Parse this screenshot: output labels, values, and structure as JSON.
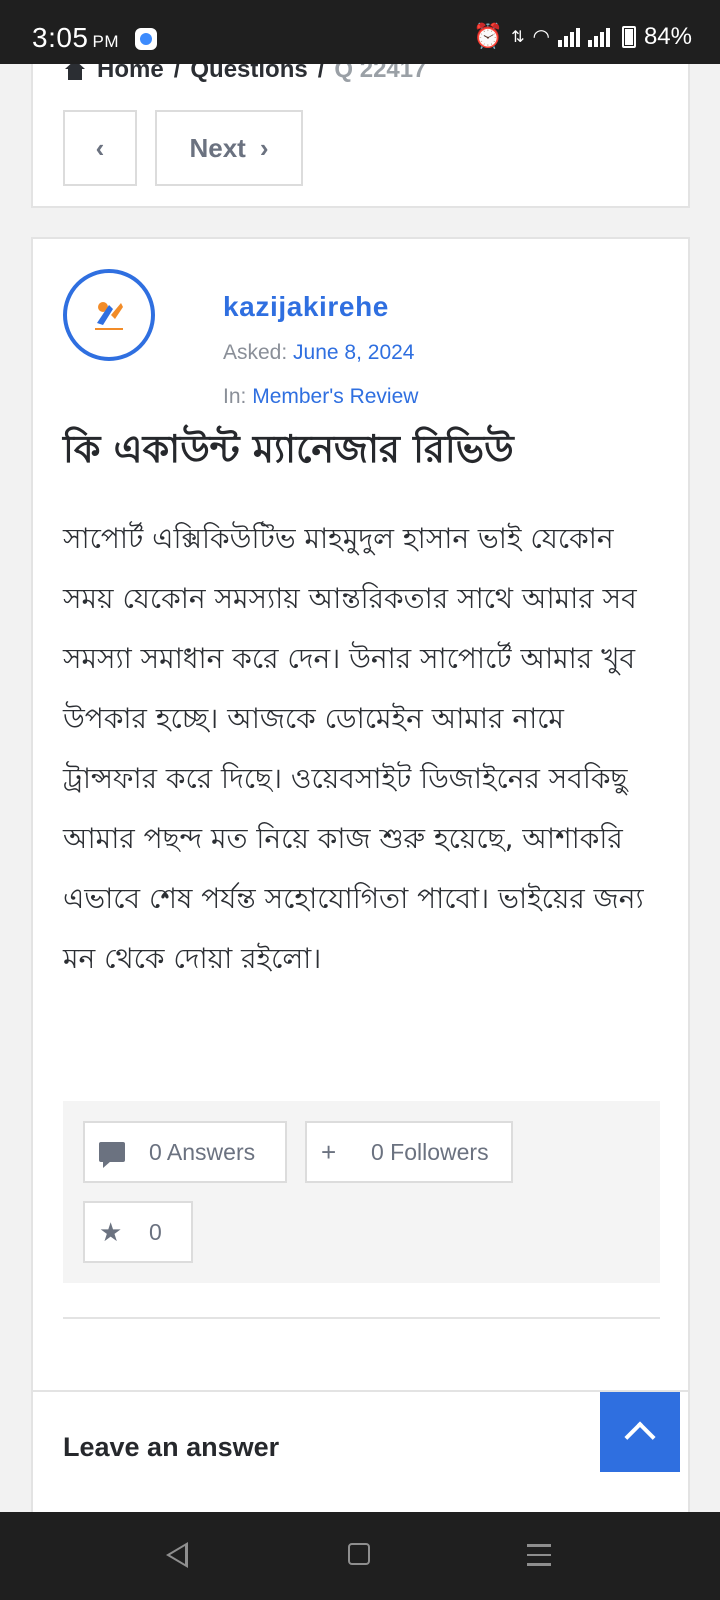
{
  "status_bar": {
    "time": "3:05",
    "ampm": "PM",
    "battery": "84%"
  },
  "breadcrumb": {
    "home": "Home",
    "sep": "/",
    "questions": "Questions",
    "current": "Q 22417"
  },
  "navigation": {
    "prev_symbol": "‹",
    "next_label": "Next",
    "next_symbol": "›"
  },
  "question": {
    "author": "kazijakirehe",
    "asked_label": "Asked:",
    "asked_date": "June 8, 2024",
    "in_label": "In:",
    "category": "Member's Review",
    "title": "কি একাউন্ট ম্যানেজার রিভিউ",
    "body": "সাপোর্ট এক্সিকিউটিভ মাহমুদুল হাসান ভাই যেকোন সময় যেকোন সমস্যায় আন্তরিকতার সাথে আমার সব সমস্যা সমাধান করে দেন। উনার সাপোর্টে আমার খুব উপকার হচ্ছে। আজকে ডোমেইন আমার নামে ট্রান্সফার করে দিছে। ওয়েবসাইট ডিজাইনের সবকিছু আমার পছন্দ মত নিয়ে কাজ শুরু হয়েছে, আশাকরি এভাবে শেষ পর্যন্ত সহোযোগিতা পাবো। ভাইয়ের জন্য মন থেকে দোয়া রইলো।"
  },
  "stats": {
    "answers": "0 Answers",
    "followers_symbol": "+",
    "followers": "0 Followers",
    "star_symbol": "★",
    "favorites": "0"
  },
  "answer_section": {
    "title": "Leave an answer"
  },
  "colors": {
    "accent": "#2f6fe0",
    "text": "#2b2e33",
    "muted": "#8a8f98"
  }
}
